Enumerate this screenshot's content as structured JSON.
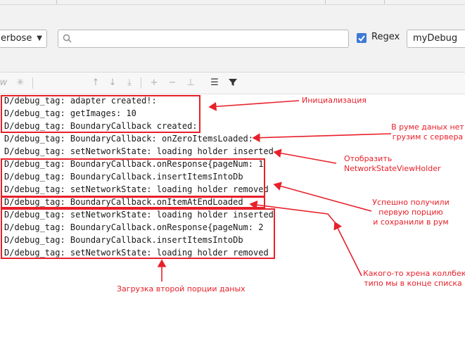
{
  "filter_bar": {
    "log_level": "erbose",
    "search_value": "",
    "regex_checked": true,
    "regex_label": "Regex",
    "filter_preset": "myDebug"
  },
  "toolbar": {
    "left_glyph": "w",
    "icons": [
      "regex-asterisk-icon",
      "scroll-up-icon",
      "scroll-down-icon",
      "import-icon",
      "add-fold-icon",
      "remove-fold-icon",
      "move-fold-icon",
      "wrap-icon",
      "filter-icon"
    ]
  },
  "log_lines": [
    "D/debug_tag: adapter created!:",
    "D/debug_tag: getImages: 10",
    "D/debug_tag: BoundaryCallback created:",
    "D/debug_tag: BoundaryCallback: onZeroItemsLoaded:",
    "D/debug_tag: setNetworkState: loading holder inserted",
    "D/debug_tag: BoundaryCallback.onResponse{pageNum: 1",
    "D/debug_tag: BoundaryCallback.insertItemsIntoDb",
    "D/debug_tag: setNetworkState: loading holder removed",
    "D/debug_tag: BoundaryCallback.onItemAtEndLoaded",
    "D/debug_tag: setNetworkState: loading holder inserted",
    "D/debug_tag: BoundaryCallback.onResponse{pageNum: 2",
    "D/debug_tag: BoundaryCallback.insertItemsIntoDb",
    "D/debug_tag: setNetworkState: loading holder removed"
  ],
  "annotations": {
    "init": "Инициализация",
    "empty_room_1": "В руме даных нет",
    "empty_room_2": "грузим с сервера",
    "show_holder_1": "Отобразить",
    "show_holder_2": "NetworkStateViewHolder",
    "first_page_1": "Успешно получили",
    "first_page_2": "первую порцию",
    "first_page_3": "и сохранили в рум",
    "end_callback_1": "Какого-то хрена коллбек",
    "end_callback_2": "типо мы в конце списка",
    "second_page": "Загрузка второй порции даных"
  },
  "colors": {
    "annotation_red": "#e8202a",
    "checkbox_blue": "#3d7ad8",
    "panel_bg": "#f2f2f2"
  }
}
